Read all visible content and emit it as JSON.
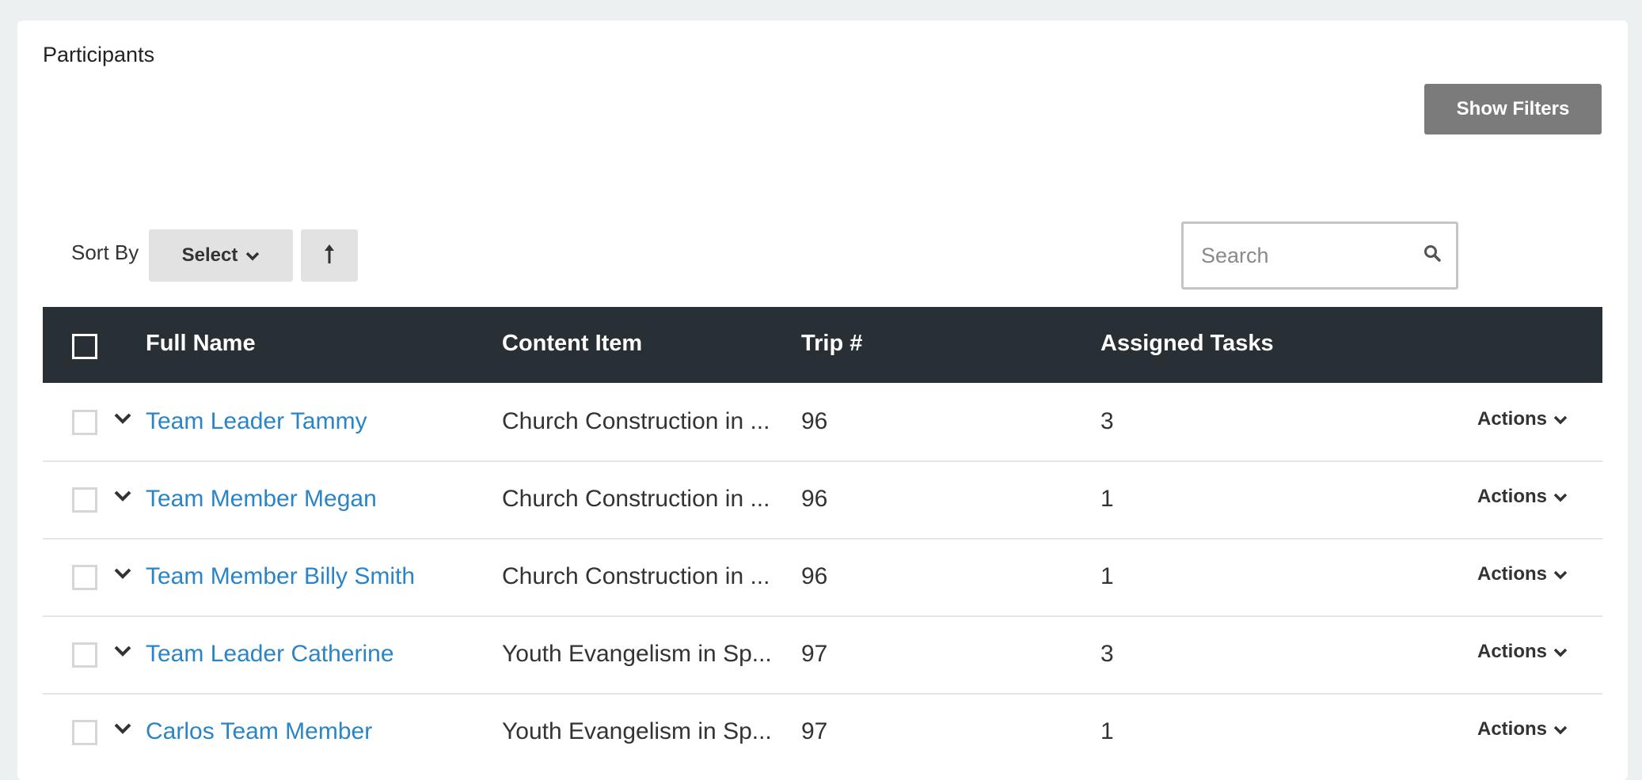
{
  "page": {
    "title": "Participants"
  },
  "toolbar": {
    "show_filters_label": "Show Filters",
    "sort_by_label": "Sort By",
    "sort_select_label": "Select",
    "search_placeholder": "Search"
  },
  "table": {
    "columns": [
      "Full Name",
      "Content Item",
      "Trip #",
      "Assigned Tasks"
    ],
    "rows": [
      {
        "name": "Team Leader Tammy",
        "content": "Church Construction in ...",
        "trip": "96",
        "tasks": "3",
        "actions": "Actions"
      },
      {
        "name": "Team Member Megan",
        "content": "Church Construction in ...",
        "trip": "96",
        "tasks": "1",
        "actions": "Actions"
      },
      {
        "name": "Team Member Billy Smith",
        "content": "Church Construction in ...",
        "trip": "96",
        "tasks": "1",
        "actions": "Actions"
      },
      {
        "name": "Team Leader Catherine",
        "content": "Youth Evangelism in Sp...",
        "trip": "97",
        "tasks": "3",
        "actions": "Actions"
      },
      {
        "name": "Carlos Team Member",
        "content": "Youth Evangelism in Sp...",
        "trip": "97",
        "tasks": "1",
        "actions": "Actions"
      }
    ]
  },
  "icons": {
    "sort_direction": "arrow-up-icon",
    "search": "search-icon",
    "row_expand": "chevron-down-icon",
    "dropdown": "chevron-down-icon"
  },
  "colors": {
    "header_bg": "#283036",
    "link": "#2a84c6",
    "filters_button": "#7b7b7b",
    "page_bg": "#ecf0f1"
  }
}
